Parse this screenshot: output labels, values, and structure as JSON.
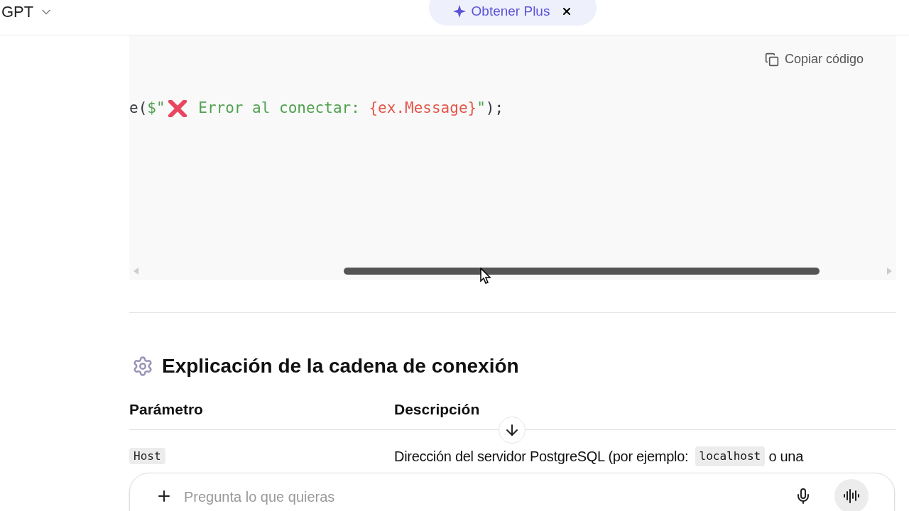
{
  "header": {
    "model": "GPT",
    "upgrade": "Obtener Plus"
  },
  "code_block": {
    "copy_label": "Copiar código",
    "tokens": [
      {
        "kind": "plain",
        "text": "e("
      },
      {
        "kind": "string",
        "text": "$\""
      },
      {
        "kind": "icon"
      },
      {
        "kind": "string",
        "text": " Error al conectar: "
      },
      {
        "kind": "interp",
        "text": "{ex.Message}"
      },
      {
        "kind": "string",
        "text": "\""
      },
      {
        "kind": "plain",
        "text": ");"
      }
    ]
  },
  "section": {
    "title": "Explicación de la cadena de conexión"
  },
  "table": {
    "columns": [
      "Parámetro",
      "Descripción"
    ],
    "rows": [
      {
        "parameter": "Host",
        "description": [
          {
            "kind": "text",
            "text": "Dirección del servidor PostgreSQL (por ejemplo: "
          },
          {
            "kind": "code",
            "text": "localhost"
          },
          {
            "kind": "text",
            "text": " o una"
          }
        ]
      }
    ]
  },
  "composer": {
    "placeholder": "Pregunta lo que quieras"
  }
}
